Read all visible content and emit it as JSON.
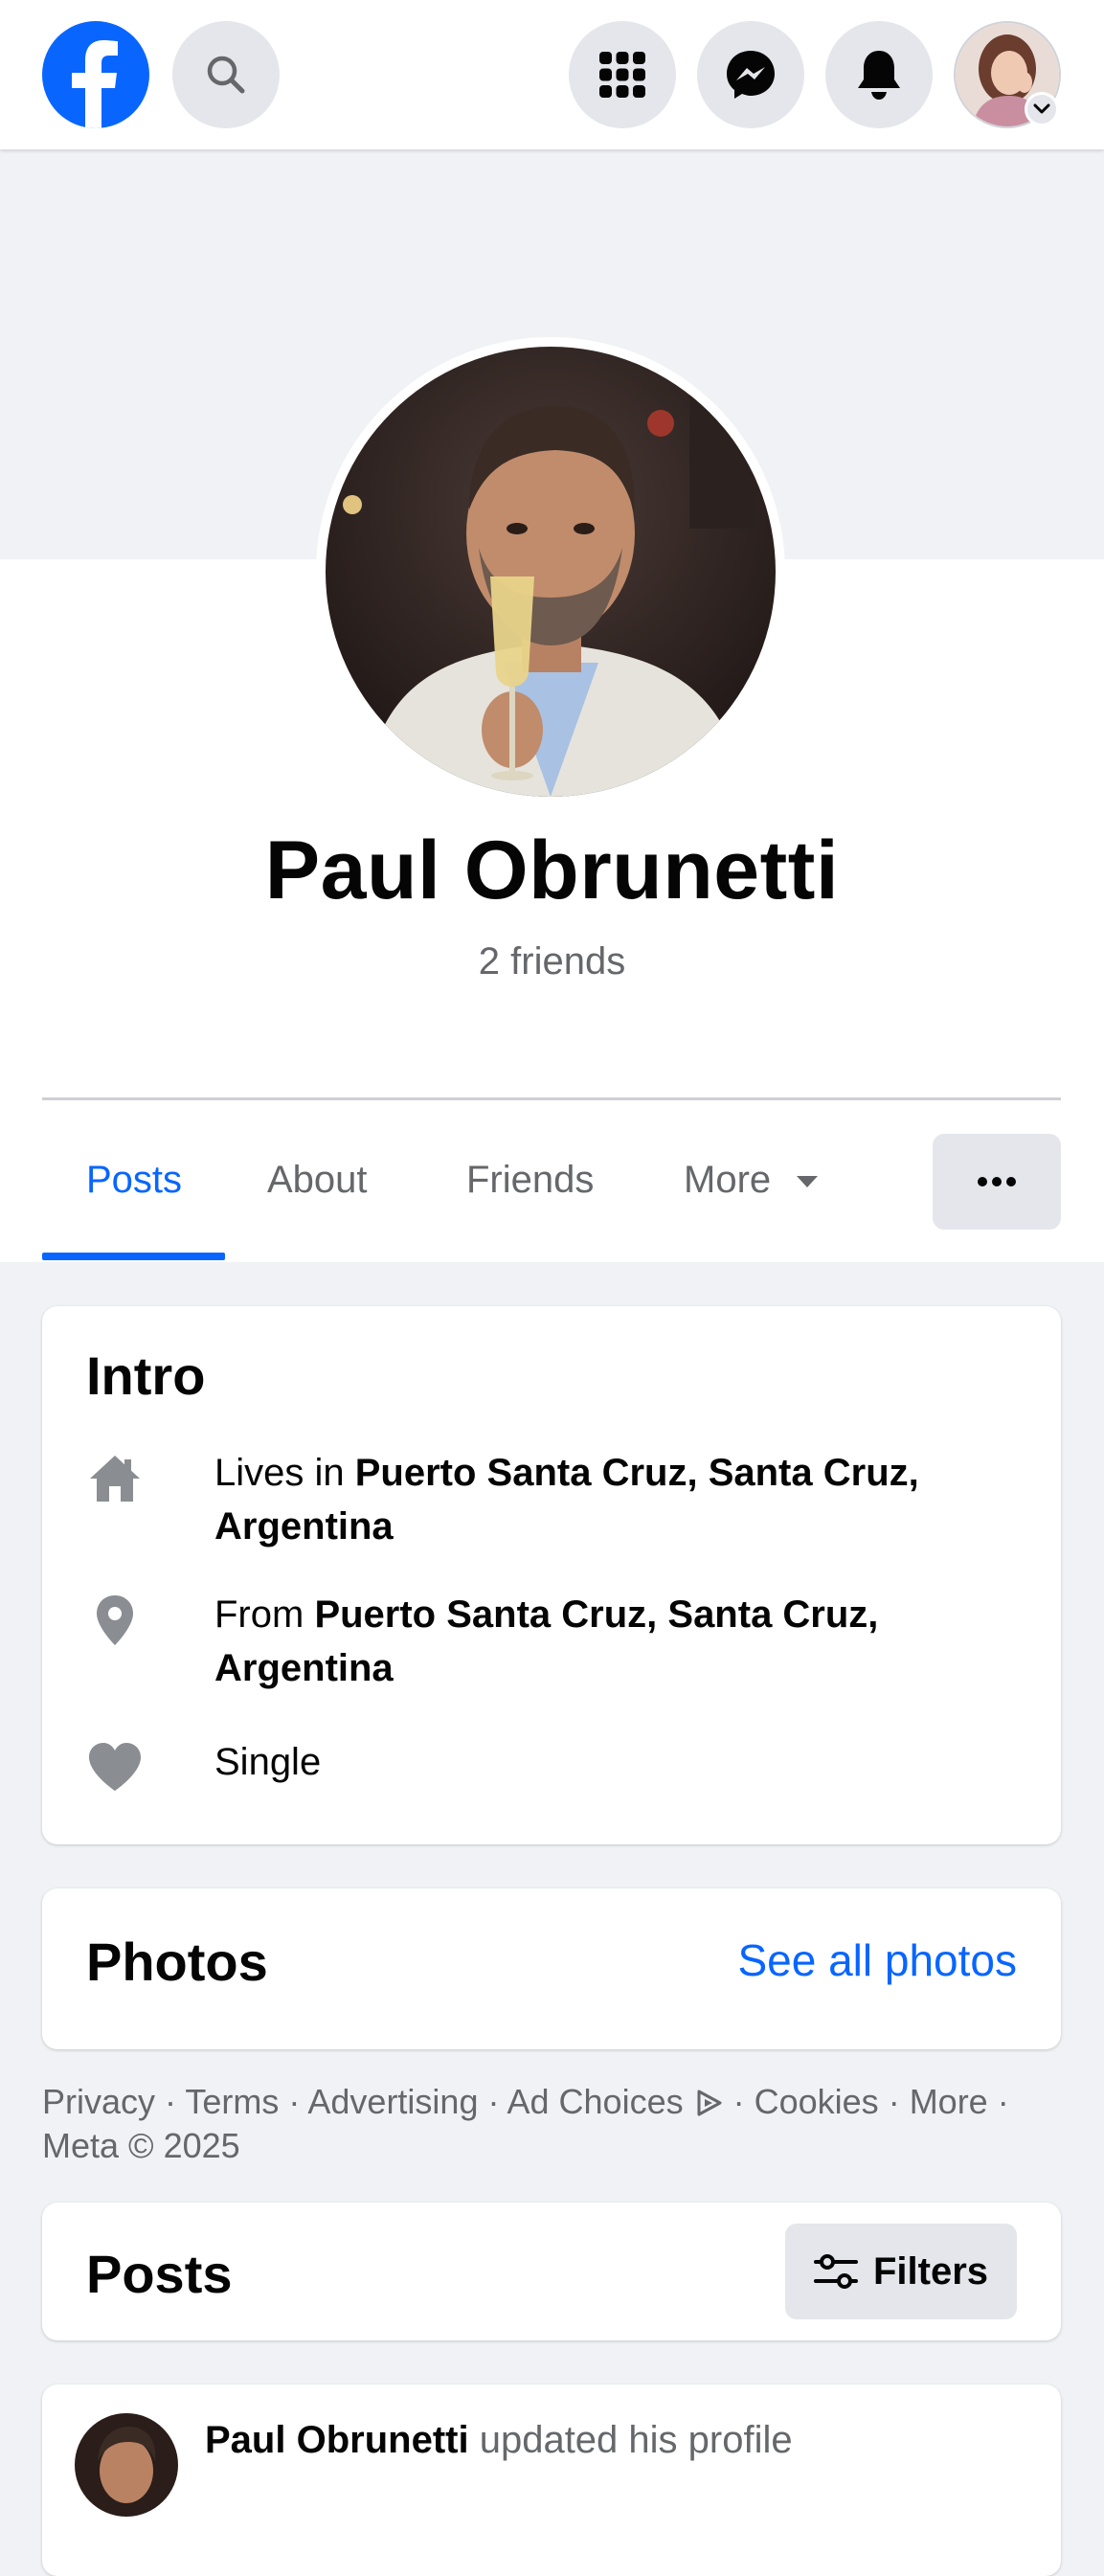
{
  "topbar": {
    "logo_icon": "facebook-logo",
    "search_icon": "search-icon",
    "menu_icon": "grid-menu-icon",
    "messenger_icon": "messenger-icon",
    "notifications_icon": "bell-icon",
    "account_icon": "account-avatar"
  },
  "profile": {
    "name": "Paul Obrunetti",
    "friends": "2 friends"
  },
  "tabs": [
    {
      "label": "Posts",
      "active": true
    },
    {
      "label": "About",
      "active": false
    },
    {
      "label": "Friends",
      "active": false
    },
    {
      "label": "More",
      "active": false
    }
  ],
  "intro": {
    "title": "Intro",
    "lives_prefix": "Lives in ",
    "lives_place": "Puerto Santa Cruz, Santa Cruz, Argentina",
    "from_prefix": "From ",
    "from_place": "Puerto Santa Cruz, Santa Cruz, Argentina",
    "relationship": "Single"
  },
  "photos": {
    "title": "Photos",
    "see_all": "See all photos"
  },
  "footer": {
    "links": [
      "Privacy",
      "Terms",
      "Advertising",
      "Ad Choices",
      "Cookies",
      "More"
    ],
    "copyright": "Meta © 2025"
  },
  "posts": {
    "title": "Posts",
    "filters": "Filters",
    "first_post_author": "Paul Obrunetti",
    "first_post_action": "updated his profile"
  },
  "colors": {
    "accent": "#0866ff",
    "background": "#f0f2f5",
    "muted_text": "#65676b"
  }
}
